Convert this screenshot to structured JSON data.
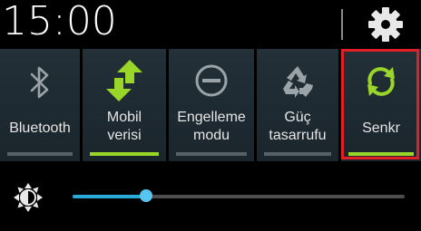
{
  "status": {
    "time": "15:00"
  },
  "quick_settings": [
    {
      "label": "Bluetooth",
      "icon": "bluetooth-icon",
      "active": false
    },
    {
      "label": "Mobil\nverisi",
      "icon": "mobile-data-icon",
      "active": true
    },
    {
      "label": "Engelleme\nmodu",
      "icon": "blocking-mode-icon",
      "active": false
    },
    {
      "label": "Güç\ntasarrufu",
      "icon": "power-saving-icon",
      "active": false
    },
    {
      "label": "Senkr",
      "icon": "sync-icon",
      "active": true,
      "highlighted": true
    }
  ],
  "settings_icon": "gear-icon",
  "brightness": {
    "icon": "brightness-icon",
    "level": 0.22
  },
  "colors": {
    "active": "#9ad62a",
    "inactive_icon": "#9aa3a8",
    "slider": "#2aa9d8",
    "highlight_border": "#e21e26"
  }
}
